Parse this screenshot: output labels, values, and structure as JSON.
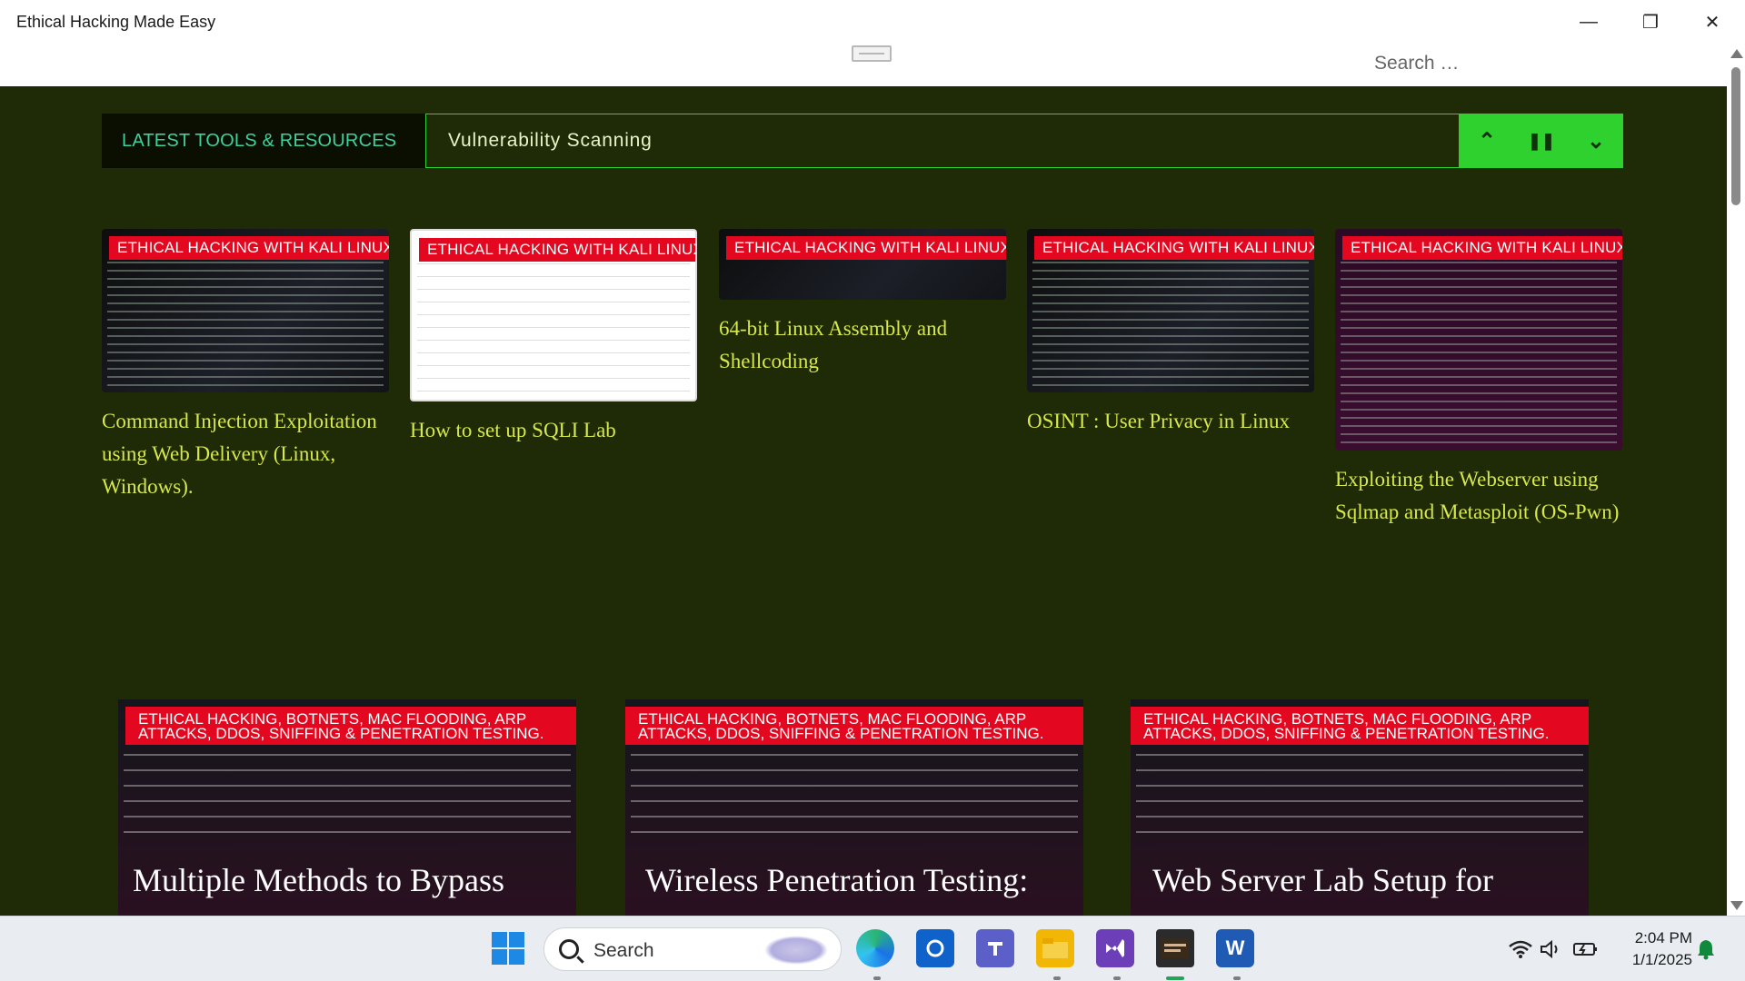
{
  "window": {
    "title": "Ethical Hacking Made Easy",
    "minimize_glyph": "—",
    "restore_glyph": "❐",
    "close_glyph": "✕"
  },
  "header": {
    "search_placeholder": "Search …"
  },
  "ticker": {
    "label": "LATEST TOOLS & RESOURCES",
    "current": "Vulnerability Scanning",
    "controls": {
      "up": "⌃",
      "pause": "❚❚",
      "down": "⌄"
    }
  },
  "posts": [
    {
      "category": "ETHICAL HACKING WITH KALI LINUX",
      "title": "Command Injection Exploitation using Web Delivery (Linux, Windows)."
    },
    {
      "category": "ETHICAL HACKING WITH KALI LINUX",
      "title": "How to set up SQLI Lab"
    },
    {
      "category": "ETHICAL HACKING WITH KALI LINUX",
      "title": "64-bit Linux Assembly and Shellcoding"
    },
    {
      "category": "ETHICAL HACKING WITH KALI LINUX",
      "title": "OSINT : User Privacy in Linux"
    },
    {
      "category": "ETHICAL HACKING WITH KALI LINUX",
      "title": "Exploiting the Webserver using Sqlmap and Metasploit (OS-Pwn)"
    }
  ],
  "featured": [
    {
      "category": "ETHICAL HACKING, BOTNETS, MAC FLOODING, ARP ATTACKS, DDOS, SNIFFING & PENETRATION TESTING.",
      "title": "Multiple Methods to Bypass"
    },
    {
      "category": "ETHICAL HACKING, BOTNETS, MAC FLOODING, ARP ATTACKS, DDOS, SNIFFING & PENETRATION TESTING.",
      "title": "Wireless Penetration Testing:"
    },
    {
      "category": "ETHICAL HACKING, BOTNETS, MAC FLOODING, ARP ATTACKS, DDOS, SNIFFING & PENETRATION TESTING.",
      "title": "Web Server Lab Setup for"
    }
  ],
  "taskbar": {
    "search_label": "Search",
    "apps": [
      "windows-start",
      "edge",
      "outlook",
      "teams",
      "file-explorer",
      "visual-studio",
      "terminal-app",
      "word"
    ],
    "word_letter": "W",
    "time": "2:04 PM",
    "date": "1/1/2025"
  },
  "colors": {
    "page_bg": "#1f2a06",
    "accent_green": "#2fd12f",
    "badge_red": "#e3081f",
    "title_yellow": "#d6e84a",
    "ticker_label": "#3fd0a0"
  }
}
